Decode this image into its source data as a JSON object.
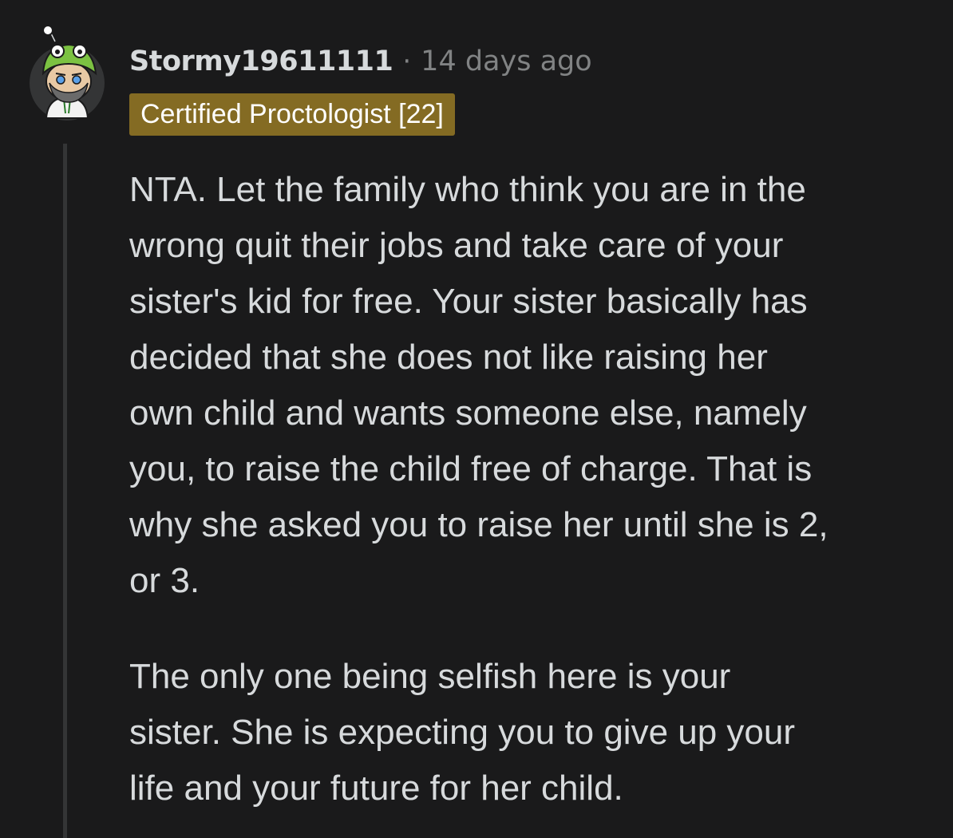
{
  "comment": {
    "username": "Stormy19611111",
    "separator": "·",
    "timestamp": "14 days ago",
    "flair": "Certified Proctologist [22]",
    "paragraphs": [
      {
        "lines": [
          "NTA. Let the family who think you are in the",
          "wrong quit their jobs and take care of your",
          "sister's kid for free. Your sister basically has",
          "decided that she does not like raising her",
          "own child and wants someone else, namely",
          "you, to raise the child free of charge. That is",
          "why she asked you to raise her until she is 2,",
          "or 3."
        ]
      },
      {
        "lines": [
          "The only one being selfish here is your",
          "sister. She is expecting you to give up your",
          "life and your future for her child."
        ]
      }
    ]
  },
  "colors": {
    "background": "#1a1a1b",
    "text": "#d7dadc",
    "meta": "#818384",
    "flair_bg": "#846b23",
    "flair_text": "#ffffff",
    "thread_line": "#343536"
  }
}
